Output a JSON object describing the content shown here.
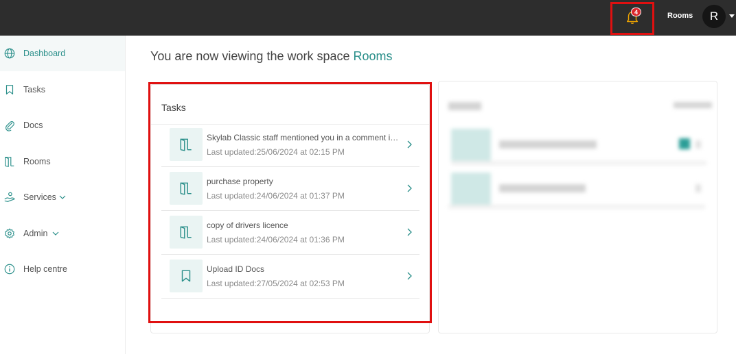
{
  "topbar": {
    "notification_count": "4",
    "workspace_name": "Rooms",
    "user_initial": "R"
  },
  "sidebar": {
    "items": [
      {
        "label": "Dashboard",
        "icon": "globe-icon",
        "active": true
      },
      {
        "label": "Tasks",
        "icon": "bookmark-icon"
      },
      {
        "label": "Docs",
        "icon": "paperclip-icon"
      },
      {
        "label": "Rooms",
        "icon": "door-icon"
      },
      {
        "label": "Services",
        "icon": "hand-icon",
        "expandable": true
      },
      {
        "label": "Admin",
        "icon": "gear-icon",
        "expandable": true
      },
      {
        "label": "Help centre",
        "icon": "info-icon"
      }
    ]
  },
  "main": {
    "heading_prefix": "You are now viewing the work space ",
    "heading_workspace": "Rooms",
    "tasks_card": {
      "title": "Tasks",
      "items": [
        {
          "title": "Skylab Classic staff mentioned you in a comment in room Rooms",
          "updated": "Last updated:25/06/2024 at 02:15 PM",
          "icon": "door-icon"
        },
        {
          "title": "purchase property",
          "updated": "Last updated:24/06/2024 at 01:37 PM",
          "icon": "door-icon"
        },
        {
          "title": "copy of drivers licence",
          "updated": "Last updated:24/06/2024 at 01:36 PM",
          "icon": "door-icon"
        },
        {
          "title": "Upload ID Docs",
          "updated": "Last updated:27/05/2024 at 02:53 PM",
          "icon": "bookmark-icon"
        }
      ]
    }
  },
  "colors": {
    "accent": "#2a8f8a",
    "topbar": "#2d2d2d",
    "highlight": "#e01010",
    "badge": "#d9262b",
    "bell": "#f0a500"
  }
}
